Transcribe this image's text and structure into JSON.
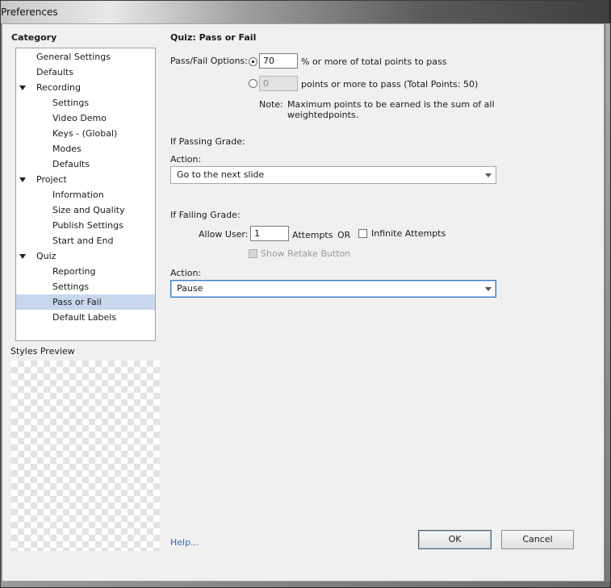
{
  "window": {
    "title": "Preferences"
  },
  "category": {
    "heading": "Category",
    "items": [
      {
        "label": "General Settings",
        "level": 0,
        "expander": false,
        "selected": false
      },
      {
        "label": "Defaults",
        "level": 0,
        "expander": false,
        "selected": false
      },
      {
        "label": "Recording",
        "level": 0,
        "expander": true,
        "selected": false
      },
      {
        "label": "Settings",
        "level": 1,
        "expander": false,
        "selected": false
      },
      {
        "label": "Video Demo",
        "level": 1,
        "expander": false,
        "selected": false
      },
      {
        "label": "Keys - (Global)",
        "level": 1,
        "expander": false,
        "selected": false
      },
      {
        "label": "Modes",
        "level": 1,
        "expander": false,
        "selected": false
      },
      {
        "label": "Defaults",
        "level": 1,
        "expander": false,
        "selected": false
      },
      {
        "label": "Project",
        "level": 0,
        "expander": true,
        "selected": false
      },
      {
        "label": "Information",
        "level": 1,
        "expander": false,
        "selected": false
      },
      {
        "label": "Size and Quality",
        "level": 1,
        "expander": false,
        "selected": false
      },
      {
        "label": "Publish Settings",
        "level": 1,
        "expander": false,
        "selected": false
      },
      {
        "label": "Start and End",
        "level": 1,
        "expander": false,
        "selected": false
      },
      {
        "label": "Quiz",
        "level": 0,
        "expander": true,
        "selected": false
      },
      {
        "label": "Reporting",
        "level": 1,
        "expander": false,
        "selected": false
      },
      {
        "label": "Settings",
        "level": 1,
        "expander": false,
        "selected": false
      },
      {
        "label": "Pass or Fail",
        "level": 1,
        "expander": false,
        "selected": true
      },
      {
        "label": "Default Labels",
        "level": 1,
        "expander": false,
        "selected": false
      }
    ]
  },
  "styles_preview": {
    "label": "Styles Preview"
  },
  "panel": {
    "title": "Quiz: Pass or Fail",
    "pass_fail_label": "Pass/Fail Options:",
    "percent_value": "70",
    "percent_suffix": "% or more of total points to pass",
    "points_value": "0",
    "points_suffix": "points or more to pass (Total Points: 50)",
    "note_label": "Note:",
    "note_line1": "Maximum points to be earned is the sum of all",
    "note_line2": "weightedpoints.",
    "passing_heading": "If Passing Grade:",
    "passing_action_label": "Action:",
    "passing_action_value": "Go to the next slide",
    "failing_heading": "If Failing Grade:",
    "allow_user_label": "Allow User:",
    "attempts_value": "1",
    "attempts_label": "Attempts",
    "or_label": "OR",
    "infinite_label": "Infinite Attempts",
    "retake_label": "Show Retake Button",
    "failing_action_label": "Action:",
    "failing_action_value": "Pause"
  },
  "footer": {
    "help_label": "Help...",
    "ok_label": "OK",
    "cancel_label": "Cancel"
  }
}
